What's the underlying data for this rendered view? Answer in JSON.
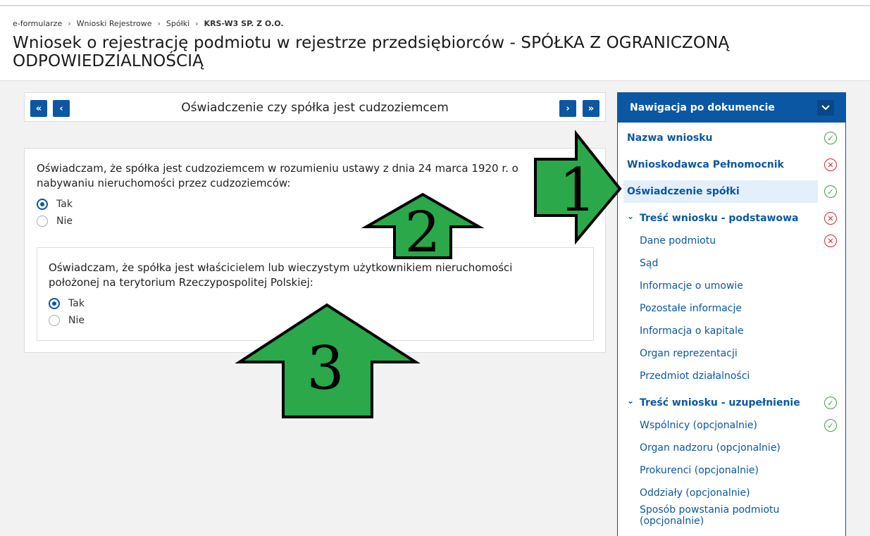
{
  "breadcrumb": [
    "e-formularze",
    "Wnioski Rejestrowe",
    "Spółki",
    "KRS-W3 SP. Z O.O."
  ],
  "page_title": "Wniosek o rejestrację podmiotu w rejestrze przedsiębiorców - SPÓŁKA Z OGRANICZONĄ ODPOWIEDZIALNOŚCIĄ",
  "pager": {
    "title": "Oświadczenie czy spółka jest cudzoziemcem",
    "first": "«",
    "prev": "‹",
    "next": "›",
    "last": "»"
  },
  "question1": {
    "text": "Oświadczam, że spółka jest cudzoziemcem w rozumieniu ustawy z dnia 24 marca 1920 r. o nabywaniu nieruchomości przez cudzoziemców:",
    "options": [
      "Tak",
      "Nie"
    ],
    "selected": "Tak"
  },
  "question2": {
    "text": "Oświadczam, że spółka jest właścicielem lub wieczystym użytkownikiem nieruchomości położonej na terytorium Rzeczypospolitej Polskiej:",
    "options": [
      "Tak",
      "Nie"
    ],
    "selected": "Tak"
  },
  "nav": {
    "header": "Nawigacja po dokumencie",
    "items": [
      {
        "label": "Nazwa wniosku",
        "kind": "top",
        "status": "ok"
      },
      {
        "label": "Wnioskodawca Pełnomocnik",
        "kind": "top",
        "status": "err"
      },
      {
        "label": "Oświadczenie spółki",
        "kind": "top",
        "status": "ok",
        "active": true
      },
      {
        "label": "Treść wniosku - podstawowa",
        "kind": "group",
        "status": "err"
      },
      {
        "label": "Dane podmiotu",
        "kind": "sub",
        "status": "err"
      },
      {
        "label": "Sąd",
        "kind": "sub"
      },
      {
        "label": "Informacje o umowie",
        "kind": "sub"
      },
      {
        "label": "Pozostałe informacje",
        "kind": "sub"
      },
      {
        "label": "Informacja o kapitale",
        "kind": "sub"
      },
      {
        "label": "Organ reprezentacji",
        "kind": "sub"
      },
      {
        "label": "Przedmiot działalności",
        "kind": "sub"
      },
      {
        "label": "Treść wniosku - uzupełnienie",
        "kind": "group",
        "status": "ok"
      },
      {
        "label": "Wspólnicy (opcjonalnie)",
        "kind": "sub",
        "status": "ok"
      },
      {
        "label": "Organ nadzoru (opcjonalnie)",
        "kind": "sub"
      },
      {
        "label": "Prokurenci (opcjonalnie)",
        "kind": "sub"
      },
      {
        "label": "Oddziały (opcjonalnie)",
        "kind": "sub"
      },
      {
        "label": "Sposób powstania podmiotu (opcjonalnie)",
        "kind": "sub"
      }
    ]
  },
  "annotations": {
    "arrow1": "1",
    "arrow2": "2",
    "arrow3": "3",
    "arrow_color": "#2aa84a"
  }
}
